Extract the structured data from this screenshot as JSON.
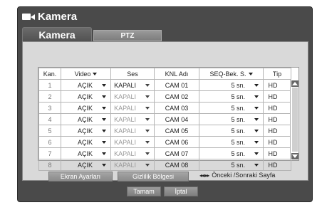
{
  "title": "Kamera",
  "tabs": [
    {
      "label": "Kamera",
      "active": true
    },
    {
      "label": "PTZ",
      "active": false
    }
  ],
  "table": {
    "headers": [
      "Kan.",
      "Video",
      "Ses",
      "KNL Adı",
      "SEQ-Bek. S.",
      "Tip"
    ],
    "rows": [
      {
        "num": "1",
        "video": "AÇIK",
        "ses": "KAPALI",
        "name": "CAM 01",
        "seq": "5 sn.",
        "tip": "HD"
      },
      {
        "num": "2",
        "video": "AÇIK",
        "ses": "KAPALI",
        "name": "CAM 02",
        "seq": "5 sn.",
        "tip": "HD"
      },
      {
        "num": "3",
        "video": "AÇIK",
        "ses": "KAPALI",
        "name": "CAM 03",
        "seq": "5 sn.",
        "tip": "HD"
      },
      {
        "num": "4",
        "video": "AÇIK",
        "ses": "KAPALI",
        "name": "CAM 04",
        "seq": "5 sn.",
        "tip": "HD"
      },
      {
        "num": "5",
        "video": "AÇIK",
        "ses": "KAPALI",
        "name": "CAM 05",
        "seq": "5 sn.",
        "tip": "HD"
      },
      {
        "num": "6",
        "video": "AÇIK",
        "ses": "KAPALI",
        "name": "CAM 06",
        "seq": "5 sn.",
        "tip": "HD"
      },
      {
        "num": "7",
        "video": "AÇIK",
        "ses": "KAPALI",
        "name": "CAM 07",
        "seq": "5 sn.",
        "tip": "HD"
      },
      {
        "num": "8",
        "video": "AÇIK",
        "ses": "KAPALI",
        "name": "CAM 08",
        "seq": "5 sn.",
        "tip": "HD"
      }
    ]
  },
  "buttons": {
    "screen_settings": "Ekran Ayarları",
    "privacy_zone": "Gizlilik Bölgesi",
    "pager": "Önceki /Sonraki Sayfa",
    "ok": "Tamam",
    "cancel": "İptal"
  },
  "colors": {
    "window_bg": "#4a4a4a",
    "panel_bg": "#d9d9d9",
    "button_bg": "#969696"
  }
}
